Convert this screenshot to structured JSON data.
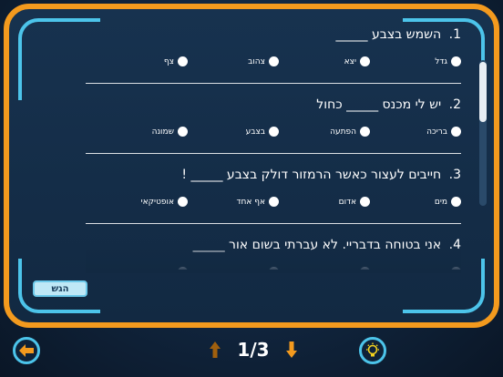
{
  "questions": [
    {
      "number": "1.",
      "text": "השמש בצבע _____",
      "options": [
        "גדל",
        "יצא",
        "צהוב",
        "צף"
      ]
    },
    {
      "number": "2.",
      "text": "יש לי מכנס _____ כחול",
      "options": [
        "בריכה",
        "הפתעה",
        "בצבע",
        "שמונה"
      ]
    },
    {
      "number": "3.",
      "text": "חייבים לעצור כאשר הרמזור דולק בצבע _____ !",
      "options": [
        "מים",
        "אדום",
        "אף אחד",
        "אופטיקאי"
      ]
    },
    {
      "number": "4.",
      "text": "אני בטוחה בדבריי. לא עברתי בשום אור _____",
      "options": [
        "",
        "",
        "",
        ""
      ]
    }
  ],
  "submit_label": "הגש",
  "pagination": {
    "current": "1/3"
  },
  "icons": {
    "back": "arrow-left-icon",
    "prev": "arrow-up-icon",
    "next": "arrow-down-icon",
    "hint": "lightbulb-icon"
  },
  "colors": {
    "frame": "#f39a1e",
    "accent": "#4cc4ea",
    "nav_arrow_inactive": "#a0600e",
    "nav_arrow_active": "#f39a1e"
  }
}
